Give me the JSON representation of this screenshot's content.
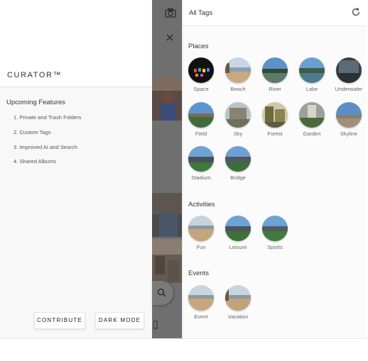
{
  "drawer": {
    "brand": "CURATOR™",
    "features_title": "Upcoming Features",
    "features": [
      "1. Private and Trash Folders",
      "2. Custom Tags",
      "3. Improved AI and Search",
      "4. Shared Albums"
    ],
    "contribute_label": "CONTRIBUTE",
    "dark_mode_label": "DARK MODE"
  },
  "middle": {
    "icons": [
      "camera-icon",
      "close-icon",
      "search-icon",
      "image-icon"
    ]
  },
  "panel": {
    "title": "All Tags",
    "refresh_icon": "refresh-icon",
    "sections": [
      {
        "title": "Places",
        "tags": [
          "Space",
          "Beach",
          "River",
          "Lake",
          "Underwater",
          "Field",
          "Sky",
          "Forest",
          "Garden",
          "Skyline",
          "Stadium",
          "Bridge"
        ]
      },
      {
        "title": "Activities",
        "tags": [
          "Fun",
          "Leisure",
          "Sports"
        ]
      },
      {
        "title": "Events",
        "tags": [
          "Event",
          "Vacation"
        ]
      }
    ]
  },
  "colors": {
    "drawer_bg": "#f8f8f8",
    "overlay": "#6f6f6f",
    "panel_bg": "#fbfbfb",
    "text": "#333333"
  }
}
